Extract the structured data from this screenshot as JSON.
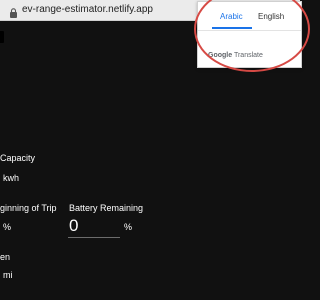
{
  "browser": {
    "url": "ev-range-estimator.netlify.app"
  },
  "form": {
    "capacity_label": "Capacity",
    "capacity_unit": "kwh",
    "beginning_label": "ginning of Trip",
    "beginning_unit": "%",
    "remaining_label": "Battery Remaining",
    "remaining_value": "0",
    "remaining_unit": "%",
    "distance_label": "en",
    "distance_unit": "mi"
  },
  "translate": {
    "tab_arabic": "Arabic",
    "tab_english": "English",
    "brand_google": "Google",
    "brand_translate": "Translate"
  },
  "colors": {
    "background": "#111111",
    "accent_blue": "#1a73e8",
    "annotation_red": "#d64a45"
  }
}
